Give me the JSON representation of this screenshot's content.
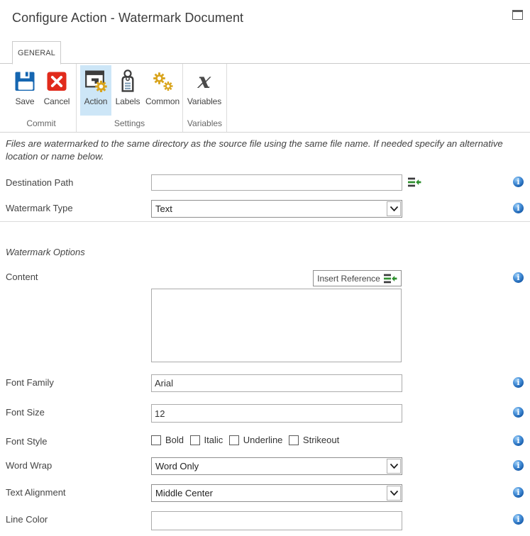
{
  "header": {
    "title": "Configure Action - Watermark Document"
  },
  "tabs": [
    {
      "label": "GENERAL"
    }
  ],
  "ribbon": {
    "groups": [
      {
        "label": "Commit",
        "buttons": [
          {
            "label": "Save",
            "icon": "save-icon"
          },
          {
            "label": "Cancel",
            "icon": "cancel-icon"
          }
        ]
      },
      {
        "label": "Settings",
        "buttons": [
          {
            "label": "Action",
            "icon": "action-icon",
            "selected": true
          },
          {
            "label": "Labels",
            "icon": "labels-icon"
          },
          {
            "label": "Common",
            "icon": "common-icon"
          }
        ]
      },
      {
        "label": "Variables",
        "buttons": [
          {
            "label": "Variables",
            "icon": "variables-icon"
          }
        ]
      }
    ]
  },
  "description": "Files are watermarked to the same directory as the source file using the same file name. If needed specify an alternative location or name below.",
  "form": {
    "section_heading": "Watermark Options",
    "insert_reference_label": "Insert Reference",
    "rows": {
      "destination_path": {
        "label": "Destination Path",
        "value": ""
      },
      "watermark_type": {
        "label": "Watermark Type",
        "value": "Text"
      },
      "content": {
        "label": "Content",
        "value": ""
      },
      "font_family": {
        "label": "Font Family",
        "value": "Arial"
      },
      "font_size": {
        "label": "Font Size",
        "value": "12"
      },
      "font_style": {
        "label": "Font Style",
        "options": [
          "Bold",
          "Italic",
          "Underline",
          "Strikeout"
        ]
      },
      "word_wrap": {
        "label": "Word Wrap",
        "value": "Word Only"
      },
      "text_alignment": {
        "label": "Text Alignment",
        "value": "Middle Center"
      },
      "line_color": {
        "label": "Line Color",
        "value": ""
      }
    }
  },
  "colors": {
    "accent_selected": "#cde6f7",
    "info_blue": "#1459a8",
    "save_blue": "#1566b1",
    "cancel_red": "#e02818",
    "gear_gold": "#d9a41d",
    "insert_green": "#2f8f2f"
  }
}
